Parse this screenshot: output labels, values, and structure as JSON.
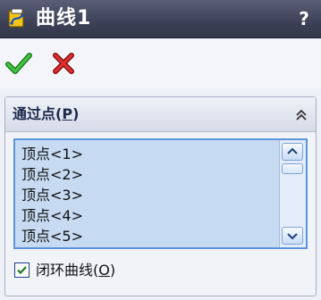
{
  "title": {
    "text": "曲线1",
    "help": "?",
    "icon": "curve-feature-icon"
  },
  "actions": {
    "ok_icon": "green-checkmark-icon",
    "cancel_icon": "red-x-icon",
    "ok_color": "#2fa12f",
    "cancel_color": "#d61e1e"
  },
  "group": {
    "title_prefix": "通过点(",
    "title_mnemonic": "P",
    "title_suffix": ")",
    "collapse_icon": "double-chevron-up-icon",
    "list_items": [
      "顶点<1>",
      "顶点<2>",
      "顶点<3>",
      "顶点<4>",
      "顶点<5>"
    ],
    "closed_curve": {
      "checked": true,
      "label_prefix": "闭环曲线(",
      "label_mnemonic": "O",
      "label_suffix": ")"
    }
  },
  "colors": {
    "titlebar": "#3d4157",
    "list_bg": "#c6daf1",
    "list_border": "#5d95dc"
  }
}
